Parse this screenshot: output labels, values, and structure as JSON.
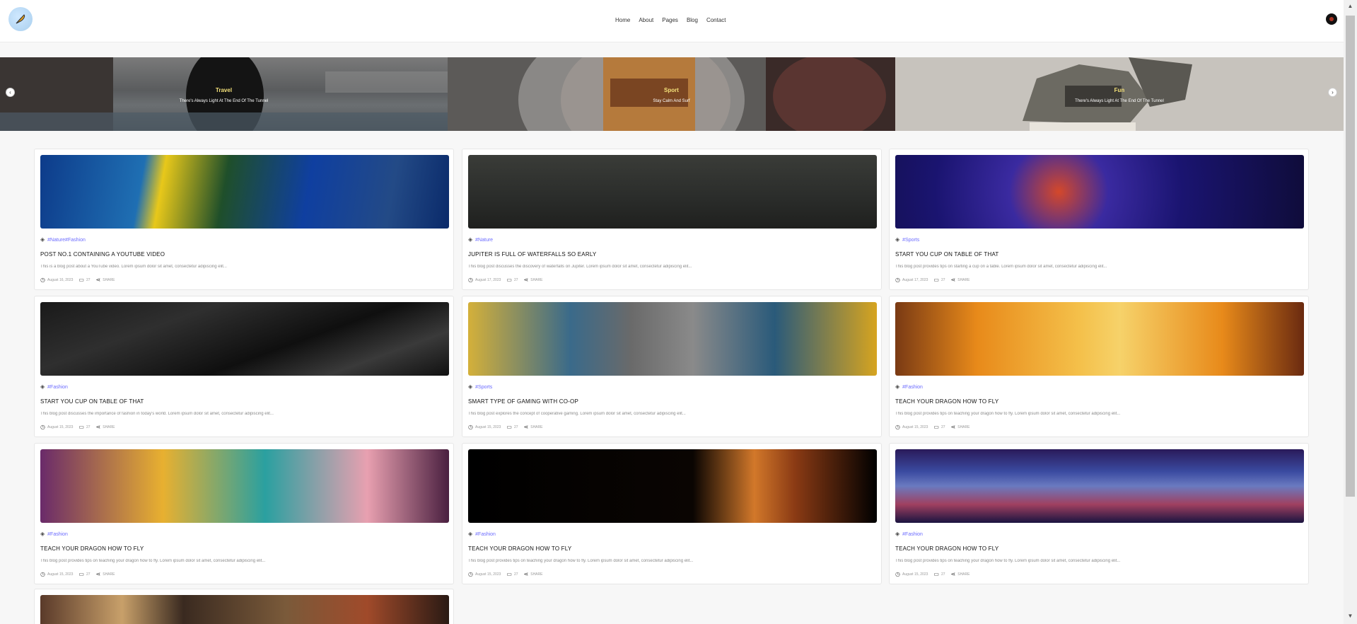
{
  "nav": {
    "items": [
      "Home",
      "About",
      "Pages",
      "Blog",
      "Contact"
    ]
  },
  "icons": {
    "logo": "feather-logo-icon",
    "avatar": "user-avatar-icon",
    "prev": "chevron-left-icon",
    "next": "chevron-right-icon",
    "tag": "tag-icon",
    "clock": "clock-icon",
    "comment": "comment-icon",
    "share": "share-icon"
  },
  "slider": {
    "slides": [
      {
        "category": "Travel",
        "subtitle": "There's Always Light At The End Of The Tunnel"
      },
      {
        "category": "Sport",
        "subtitle": "Stay Calm And Surf"
      },
      {
        "category": "Fun",
        "subtitle": "There's Always Light At The End Of The Tunnel"
      }
    ]
  },
  "posts": [
    {
      "tags": "#Nature#Fashion",
      "title": "POST NO.1 CONTAINING A YOUTUBE VIDEO",
      "desc": "This is a blog post about a YouTube video. Lorem ipsum dolor sit amet, consectetur adipiscing elit...",
      "date": "August 16, 2023",
      "comments": "27",
      "share": "SHARE"
    },
    {
      "tags": "#Nature",
      "title": "JUPITER IS FULL OF WATERFALLS SO EARLY",
      "desc": "This blog post discusses the discovery of waterfalls on Jupiter. Lorem ipsum dolor sit amet, consectetur adipiscing elit...",
      "date": "August 17, 2023",
      "comments": "27",
      "share": "SHARE"
    },
    {
      "tags": "#Sports",
      "title": "START YOU CUP ON TABLE OF THAT",
      "desc": "This blog post provides tips on starting a cup on a table. Lorem ipsum dolor sit amet, consectetur adipiscing elit...",
      "date": "August 17, 2023",
      "comments": "27",
      "share": "SHARE"
    },
    {
      "tags": "#Fashion",
      "title": "START YOU CUP ON TABLE OF THAT",
      "desc": "This blog post discusses the importance of fashion in today's world. Lorem ipsum dolor sit amet, consectetur adipiscing elit...",
      "date": "August 15, 2023",
      "comments": "27",
      "share": "SHARE"
    },
    {
      "tags": "#Sports",
      "title": "SMART TYPE OF GAMING WITH CO-OP",
      "desc": "This blog post explores the concept of cooperative gaming. Lorem ipsum dolor sit amet, consectetur adipiscing elit...",
      "date": "August 15, 2023",
      "comments": "27",
      "share": "SHARE"
    },
    {
      "tags": "#Fashion",
      "title": "TEACH YOUR DRAGON HOW TO FLY",
      "desc": "This blog post provides tips on teaching your dragon how to fly. Lorem ipsum dolor sit amet, consectetur adipiscing elit...",
      "date": "August 15, 2023",
      "comments": "27",
      "share": "SHARE"
    },
    {
      "tags": "#Fashion",
      "title": "TEACH YOUR DRAGON HOW TO FLY",
      "desc": "This blog post provides tips on teaching your dragon how to fly. Lorem ipsum dolor sit amet, consectetur adipiscing elit...",
      "date": "August 15, 2023",
      "comments": "27",
      "share": "SHARE"
    },
    {
      "tags": "#Fashion",
      "title": "TEACH YOUR DRAGON HOW TO FLY",
      "desc": "This blog post provides tips on teaching your dragon how to fly. Lorem ipsum dolor sit amet, consectetur adipiscing elit...",
      "date": "August 15, 2023",
      "comments": "27",
      "share": "SHARE"
    },
    {
      "tags": "#Fashion",
      "title": "TEACH YOUR DRAGON HOW TO FLY",
      "desc": "This blog post provides tips on teaching your dragon how to fly. Lorem ipsum dolor sit amet, consectetur adipiscing elit...",
      "date": "August 15, 2023",
      "comments": "27",
      "share": "SHARE"
    }
  ]
}
